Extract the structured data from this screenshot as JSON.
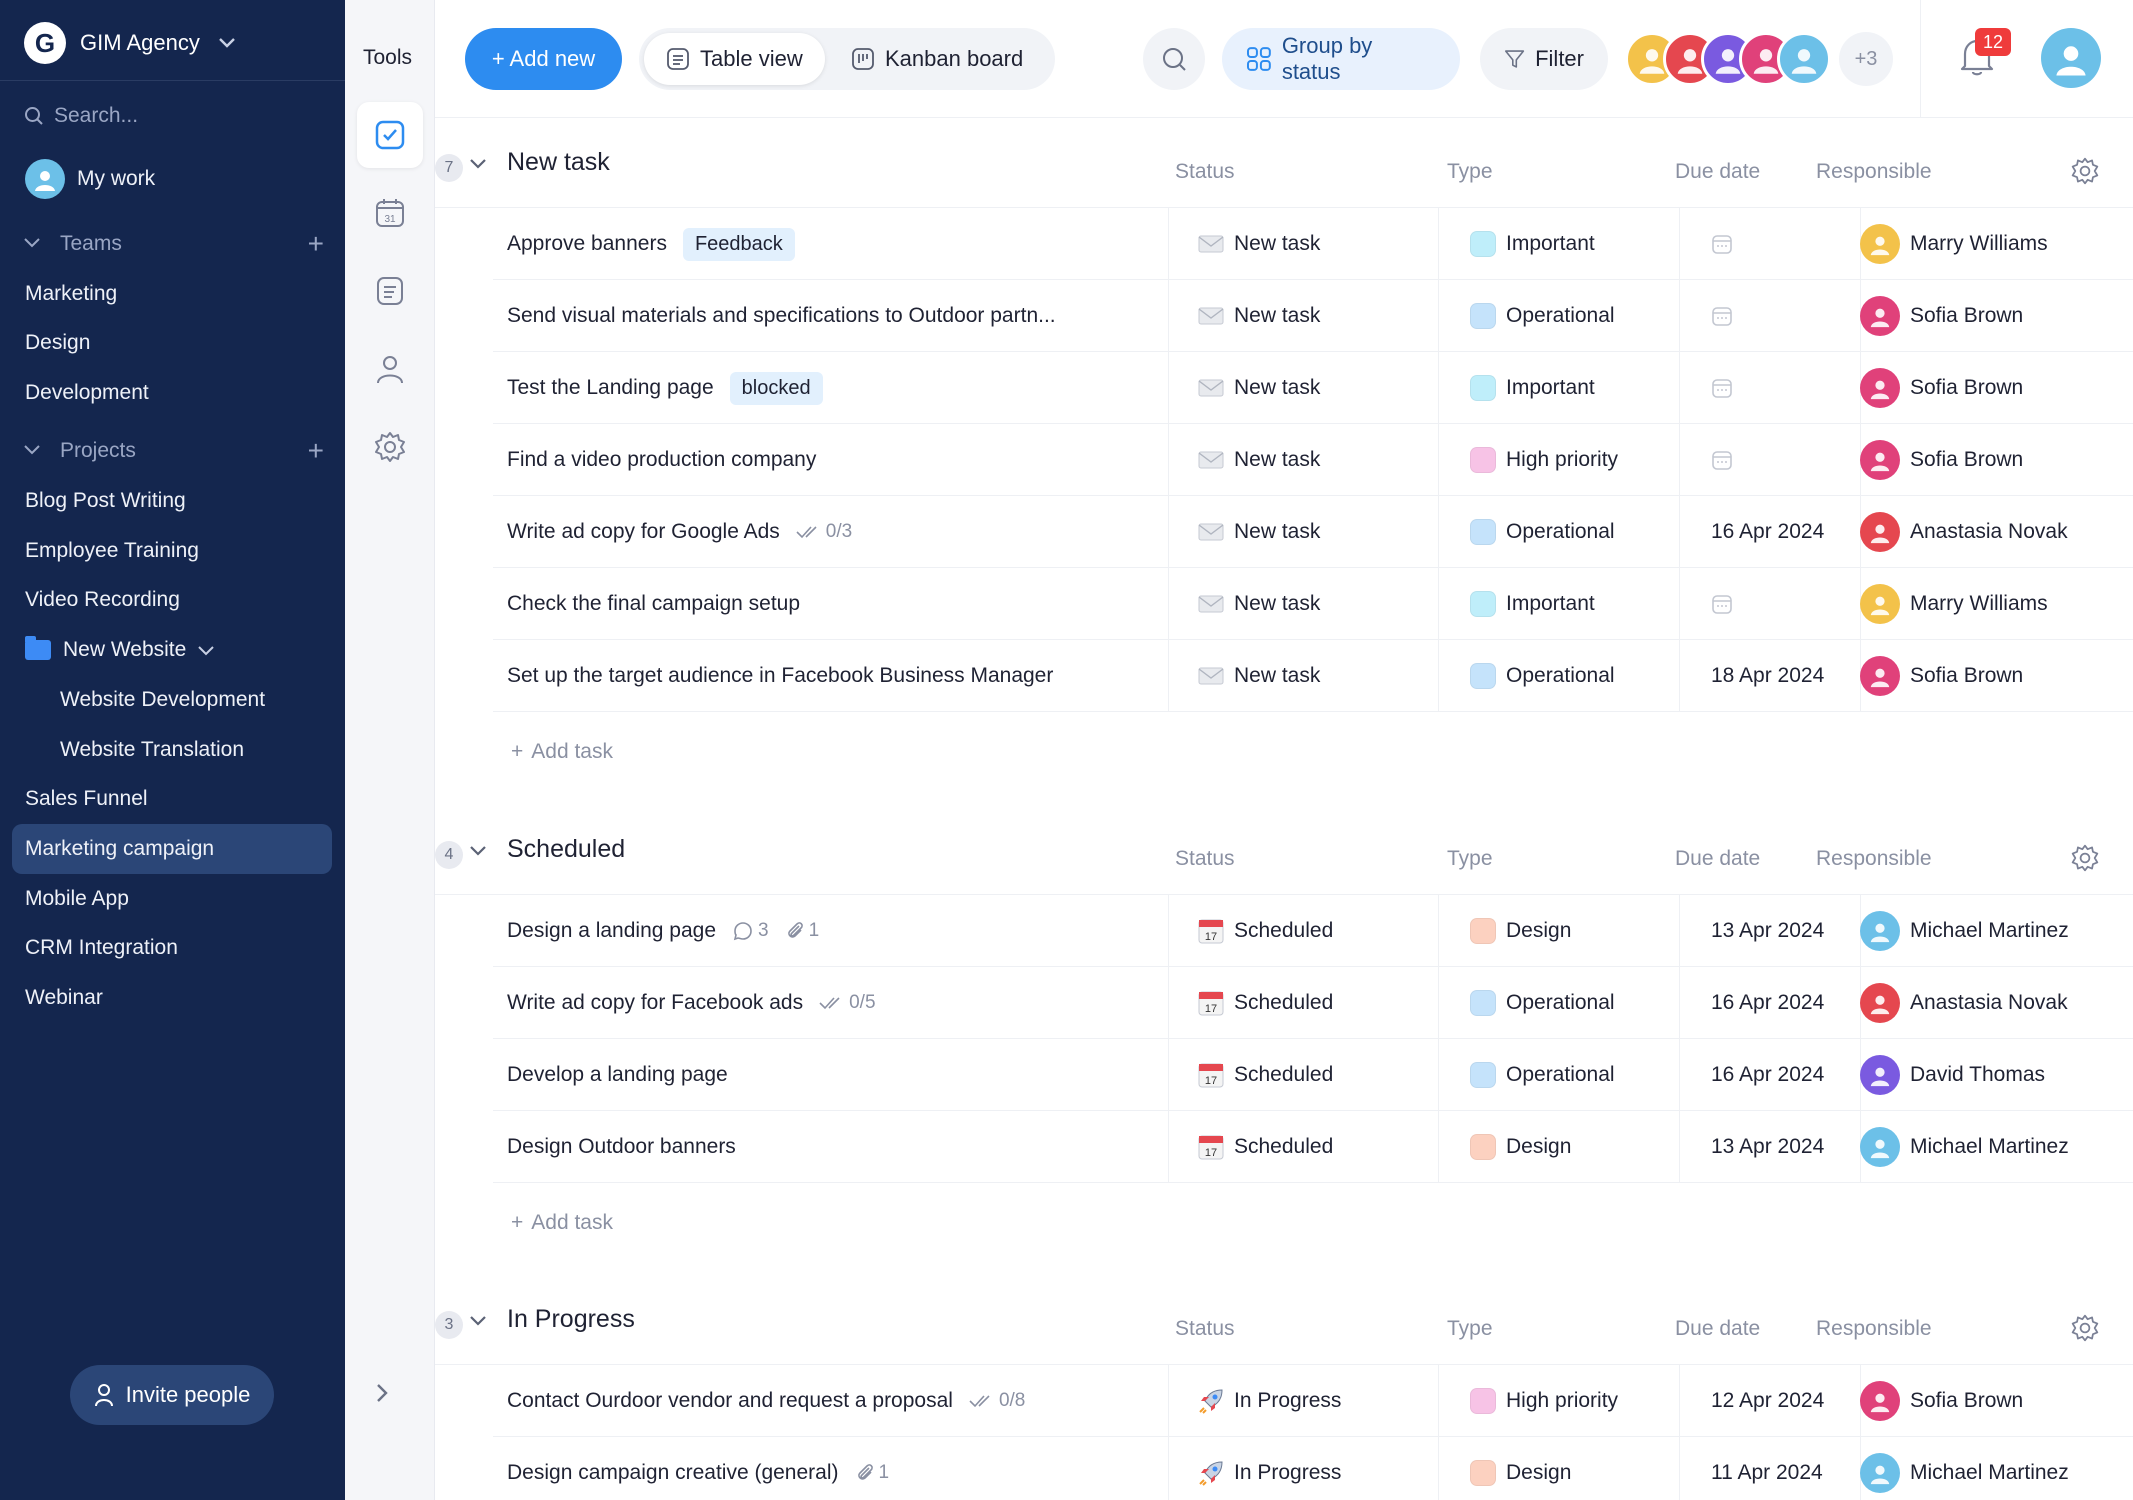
{
  "workspace": {
    "logo": "G",
    "name": "GIM Agency"
  },
  "sidebar": {
    "search_placeholder": "Search...",
    "my_work": "My work",
    "teams_label": "Teams",
    "teams": [
      "Marketing",
      "Design",
      "Development"
    ],
    "projects_label": "Projects",
    "projects": [
      {
        "label": "Blog Post Writing"
      },
      {
        "label": "Employee Training"
      },
      {
        "label": "Video Recording"
      },
      {
        "label": "New Website"
      },
      {
        "label": "Website Development"
      },
      {
        "label": "Website Translation"
      },
      {
        "label": "Sales Funnel"
      },
      {
        "label": "Marketing campaign"
      },
      {
        "label": "Mobile App"
      },
      {
        "label": "CRM Integration"
      },
      {
        "label": "Webinar"
      }
    ],
    "active_project": "Marketing campaign",
    "invite_label": "Invite people"
  },
  "tools": {
    "title": "Tools",
    "items": [
      "tasks-icon",
      "calendar-icon",
      "notes-icon",
      "user-icon",
      "settings-icon"
    ]
  },
  "toolbar": {
    "add_new": "+ Add new",
    "table_view": "Table view",
    "kanban_board": "Kanban board",
    "group_by": "Group by status",
    "filter": "Filter",
    "more_members": "+3",
    "notifications": "12"
  },
  "columns": {
    "status": "Status",
    "type": "Type",
    "due": "Due date",
    "responsible": "Responsible"
  },
  "type_colors": {
    "Important": "#bfeefa",
    "Operational": "#c5e3fb",
    "High priority": "#f7c3e6",
    "Design": "#fcd1c0"
  },
  "groups": [
    {
      "title": "New task",
      "count": "7",
      "add_label": "Add task",
      "rows": [
        {
          "name": "Approve banners",
          "tag": "Feedback",
          "status": "New task",
          "type": "Important",
          "due": "",
          "resp": "Marry Williams"
        },
        {
          "name": "Send visual materials and specifications to Outdoor partn...",
          "status": "New task",
          "type": "Operational",
          "due": "",
          "resp": "Sofia Brown"
        },
        {
          "name": "Test the Landing page",
          "tag": "blocked",
          "status": "New task",
          "type": "Important",
          "due": "",
          "resp": "Sofia Brown"
        },
        {
          "name": "Find a video production company",
          "status": "New task",
          "type": "High priority",
          "due": "",
          "resp": "Sofia Brown"
        },
        {
          "name": "Write ad copy for Google Ads",
          "meta": "0/3",
          "status": "New task",
          "type": "Operational",
          "due": "16 Apr 2024",
          "resp": "Anastasia Novak"
        },
        {
          "name": "Check the final campaign setup",
          "status": "New task",
          "type": "Important",
          "due": "",
          "resp": "Marry Williams"
        },
        {
          "name": "Set up the target audience in Facebook Business Manager",
          "status": "New task",
          "type": "Operational",
          "due": "18 Apr 2024",
          "resp": "Sofia Brown"
        }
      ]
    },
    {
      "title": "Scheduled",
      "count": "4",
      "add_label": "Add task",
      "rows": [
        {
          "name": "Design a landing page",
          "comments": "3",
          "attachments": "1",
          "status": "Scheduled",
          "type": "Design",
          "due": "13 Apr 2024",
          "resp": "Michael Martinez"
        },
        {
          "name": "Write ad copy for Facebook ads",
          "meta": "0/5",
          "status": "Scheduled",
          "type": "Operational",
          "due": "16 Apr 2024",
          "resp": "Anastasia Novak"
        },
        {
          "name": "Develop a landing page",
          "status": "Scheduled",
          "type": "Operational",
          "due": "16 Apr 2024",
          "resp": "David Thomas"
        },
        {
          "name": "Design Outdoor banners",
          "status": "Scheduled",
          "type": "Design",
          "due": "13 Apr 2024",
          "resp": "Michael Martinez"
        }
      ]
    },
    {
      "title": "In Progress",
      "count": "3",
      "rows": [
        {
          "name": "Contact Ourdoor vendor and request a proposal",
          "meta": "0/8",
          "status": "In Progress",
          "type": "High priority",
          "due": "12 Apr 2024",
          "resp": "Sofia Brown"
        },
        {
          "name": "Design campaign creative (general)",
          "attachments": "1",
          "status": "In Progress",
          "type": "Design",
          "due": "11 Apr 2024",
          "resp": "Michael Martinez"
        }
      ]
    }
  ],
  "people_colors": {
    "Marry Williams": "#f3c24a",
    "Sofia Brown": "#e0417a",
    "Anastasia Novak": "#e5474f",
    "Michael Martinez": "#6cc0e8",
    "David Thomas": "#7a5ae0"
  },
  "header_avatars": [
    "#f3c24a",
    "#e5474f",
    "#7a5ae0",
    "#e0417a",
    "#6cc0e8"
  ]
}
